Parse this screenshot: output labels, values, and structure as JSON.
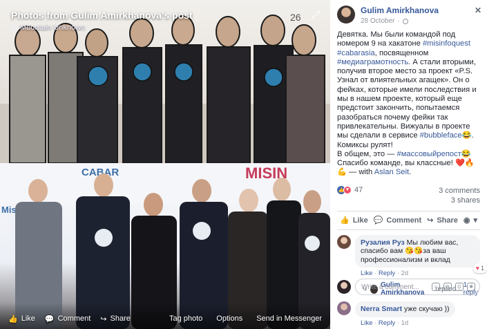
{
  "viewer": {
    "title": "Photos from Gulim Amirkhanova's post",
    "subtitle": "Mountain Unknown",
    "banner_top": "MISIN",
    "banner_brand": "CABAR",
    "banner_sub": "Misinf quest",
    "actions": {
      "like": "Like",
      "comment": "Comment",
      "share": "Share"
    },
    "links": {
      "tag": "Tag photo",
      "options": "Options",
      "messenger": "Send in Messenger"
    }
  },
  "post": {
    "author": "Gulim Amirkhanova",
    "date": "28 October",
    "text_parts": [
      "Девятка. Мы были командой под номером 9 на хакатоне ",
      "#misinfoquest",
      " ",
      "#cabarasia",
      ", посвященном ",
      "#медиаграмотность",
      ". А стали вторыми, получив второе место за проект «P.S. Узнал от влиятельных агащек». Он о фейках, которые имели последствия и мы в нашем проекте, который еще предстоит закончить, попытаемся разобраться почему фейки так привлекательны. Вижуалы в проекте мы сделали в сервисе ",
      "#bubbleface",
      "😂. Комиксы рулят!",
      "В общем, это — ",
      "#массовыйрепост",
      "😂",
      "Спасибо команде, вы классные! ❤️🔥💪 — with ",
      "Aslan Seit",
      "."
    ],
    "reaction_count": "47",
    "comments_count": "3 comments",
    "shares_count": "3 shares",
    "actions": {
      "like": "Like",
      "comment": "Comment",
      "share": "Share"
    }
  },
  "comments": [
    {
      "name": "Рузалия Руз",
      "text": "Мы любим вас, спасибо вам 😘😘за ваш профессионализм и вклад",
      "like": "Like",
      "reply": "Reply",
      "time": "2d",
      "reaction_badge": "1",
      "reply_author": "Gulim Amirkhanova",
      "reply_text": "replied",
      "reply_count": "1 reply"
    },
    {
      "name": "Nerra Smart",
      "text": "уже скучаю ))",
      "like": "Like",
      "reply": "Reply",
      "time": "1d"
    }
  ],
  "composer": {
    "placeholder": "Write a comment..."
  },
  "colors": {
    "link": "#365899",
    "secondary": "#90949c",
    "like_blue": "#4267b2",
    "love_red": "#f25268"
  }
}
